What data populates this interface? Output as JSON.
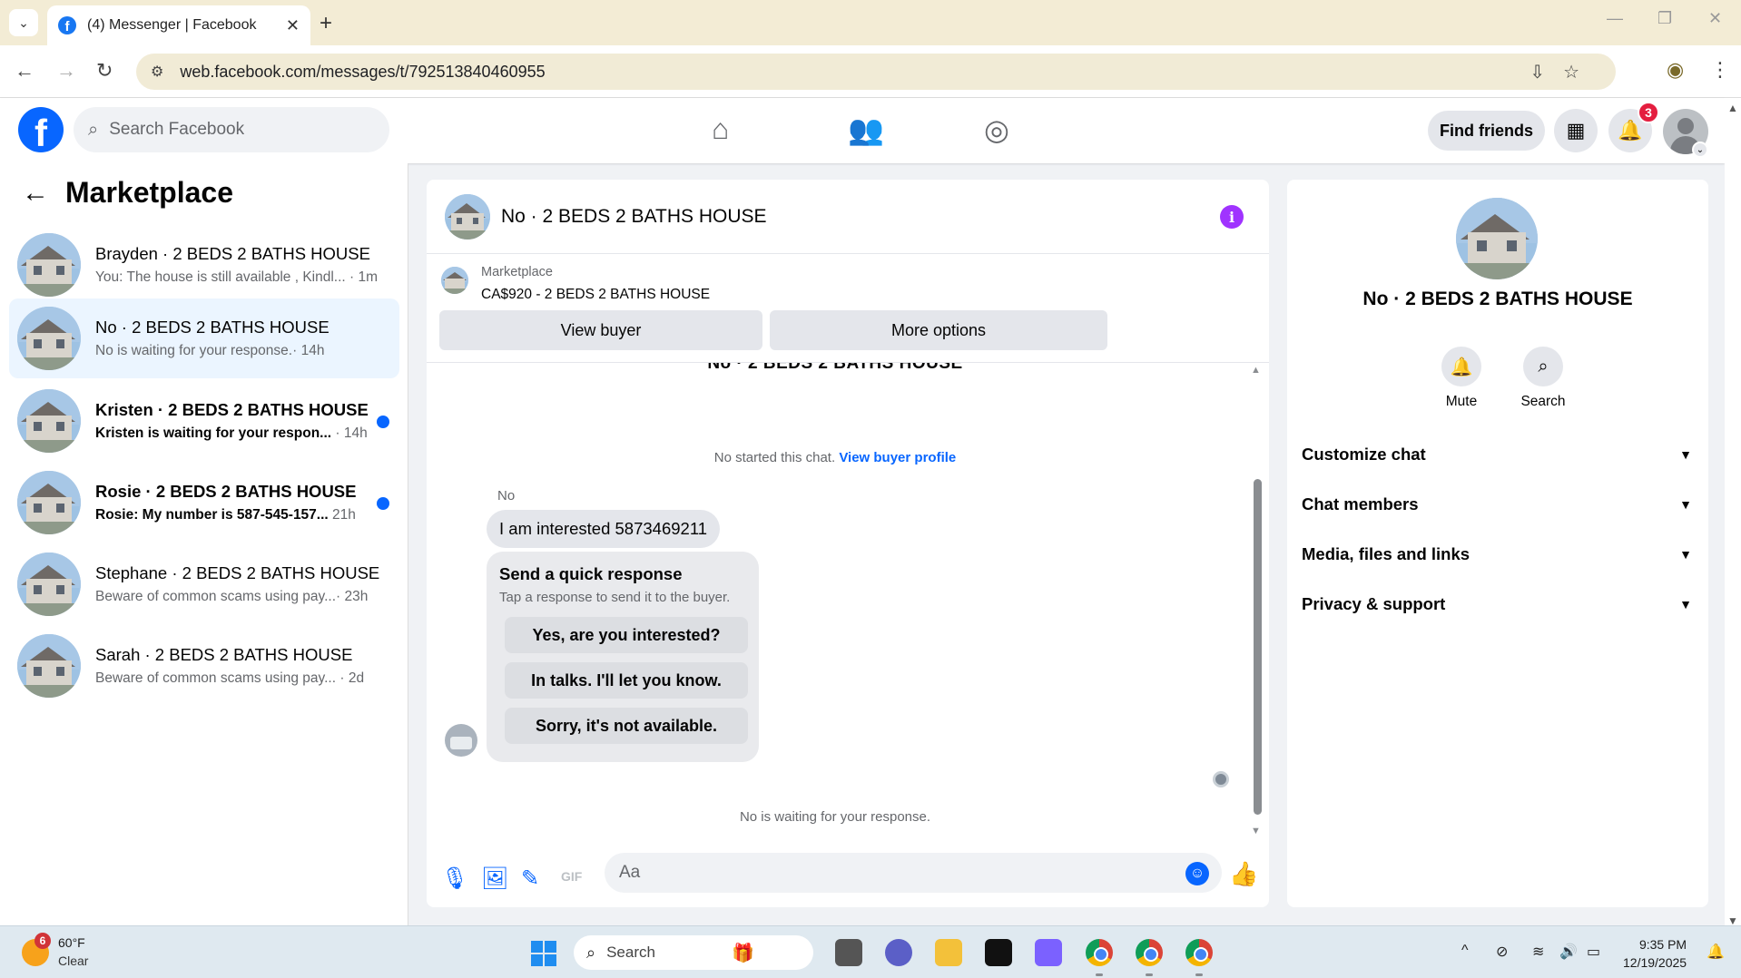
{
  "browser": {
    "tab_title": "(4) Messenger | Facebook",
    "url": "web.facebook.com/messages/t/792513840460955",
    "new_tab": "+",
    "close_tab": "✕"
  },
  "fb": {
    "logo": "f",
    "search_placeholder": "Search Facebook",
    "find_friends": "Find friends",
    "notifications_count": "3",
    "nav_icons": [
      "home-icon",
      "friends-icon",
      "groups-icon"
    ]
  },
  "sidebar": {
    "title": "Marketplace",
    "conversations": [
      {
        "name": "Brayden · 2 BEDS 2 BATHS HOUSE",
        "preview": "You: The house is still available , Kindl...",
        "time": "· 1m",
        "unread": false,
        "active": false
      },
      {
        "name": "No · 2 BEDS 2 BATHS HOUSE",
        "preview": "No is waiting for your response.",
        "time": "· 14h",
        "unread": false,
        "active": true
      },
      {
        "name": "Kristen · 2 BEDS 2 BATHS HOUSE",
        "preview": "Kristen is waiting for your respon...",
        "time": "· 14h",
        "unread": true,
        "active": false
      },
      {
        "name": "Rosie · 2 BEDS 2 BATHS HOUSE",
        "preview": "Rosie: My number is 587-545-157...",
        "time": "21h",
        "unread": true,
        "active": false
      },
      {
        "name": "Stephane · 2 BEDS 2 BATHS HOUSE",
        "preview": "Beware of common scams using pay...",
        "time": "· 23h",
        "unread": false,
        "active": false
      },
      {
        "name": "Sarah · 2 BEDS 2 BATHS HOUSE",
        "preview": "Beware of common scams using pay...",
        "time": "· 2d",
        "unread": false,
        "active": false
      }
    ]
  },
  "chat": {
    "title": "No · 2 BEDS 2 BATHS HOUSE",
    "marketplace_label": "Marketplace",
    "listing": "CA$920 - 2 BEDS 2 BATHS HOUSE",
    "view_buyer": "View buyer",
    "more_options": "More options",
    "cut_title": "No · 2 BEDS 2 BATHS HOUSE",
    "started_text": "No started this chat.",
    "view_buyer_profile": "View buyer profile",
    "sender": "No",
    "message": "I am interested 5873469211",
    "quick_title": "Send a quick response",
    "quick_sub": "Tap a response to send it to the buyer.",
    "quick_replies": [
      "Yes, are you interested?",
      "In talks. I'll let you know.",
      "Sorry, it's not available."
    ],
    "waiting": "No is waiting for your response.",
    "composer_placeholder": "Aa"
  },
  "info": {
    "name": "No · 2 BEDS 2 BATHS HOUSE",
    "actions": [
      "Mute",
      "Search"
    ],
    "sections": [
      "Customize chat",
      "Chat members",
      "Media, files and links",
      "Privacy & support"
    ]
  },
  "taskbar": {
    "weather_badge": "6",
    "temp": "60°F",
    "condition": "Clear",
    "search": "Search",
    "time": "9:35 PM",
    "date": "12/19/2025"
  },
  "colors": {
    "fb_blue": "#0866ff",
    "active_conv": "#ebf5ff",
    "info_purple": "#a033ff",
    "badge_red": "#e41e3f"
  }
}
